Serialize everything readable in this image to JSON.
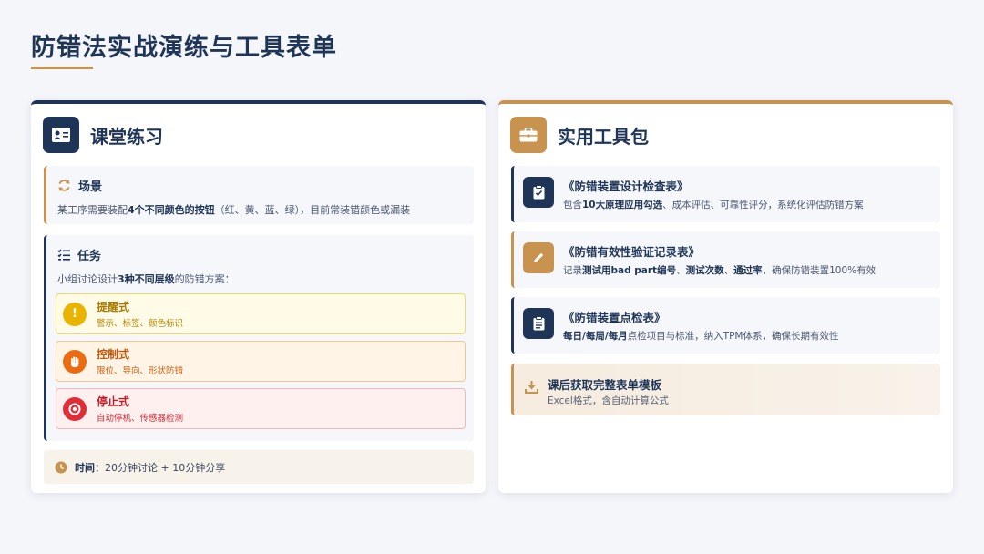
{
  "page": {
    "title": "防错法实战演练与工具表单"
  },
  "exercise": {
    "title": "课堂练习",
    "scene": {
      "label": "场景",
      "text_before": "某工序需要装配",
      "text_bold": "4个不同颜色的按钮",
      "text_after": "（红、黄、蓝、绿），目前常装错颜色或漏装"
    },
    "task": {
      "label": "任务",
      "intro_before": "小组讨论设计",
      "intro_bold": "3种不同层级",
      "intro_after": "的防错方案：",
      "levels": [
        {
          "name": "提醒式",
          "desc": "警示、标签、颜色标识",
          "icon": "!",
          "color": "#e8b400"
        },
        {
          "name": "控制式",
          "desc": "限位、导向、形状防错",
          "icon": "hand-icon",
          "color": "#ec6b10"
        },
        {
          "name": "停止式",
          "desc": "自动停机、传感器检测",
          "icon": "stop-icon",
          "color": "#e12d37"
        }
      ]
    },
    "time": {
      "label": "时间",
      "value": "：20分钟讨论 + 10分钟分享"
    }
  },
  "toolkit": {
    "title": "实用工具包",
    "tools": [
      {
        "name": "《防错装置设计检查表》",
        "desc_parts": [
          {
            "text": "包含",
            "bold": false
          },
          {
            "text": "10大原理应用勾选",
            "bold": true
          },
          {
            "text": "、成本评估、可靠性评分，系统化评估防错方案",
            "bold": false
          }
        ]
      },
      {
        "name": "《防错有效性验证记录表》",
        "desc_parts": [
          {
            "text": "记录",
            "bold": false
          },
          {
            "text": "测试用bad part编号",
            "bold": true
          },
          {
            "text": "、",
            "bold": false
          },
          {
            "text": "测试次数",
            "bold": true
          },
          {
            "text": "、",
            "bold": false
          },
          {
            "text": "通过率",
            "bold": true
          },
          {
            "text": "，确保防错装置100%有效",
            "bold": false
          }
        ]
      },
      {
        "name": "《防错装置点检表》",
        "desc_parts": [
          {
            "text": "每日/每周/每月",
            "bold": true
          },
          {
            "text": "点检项目与标准，纳入TPM体系，确保长期有效性",
            "bold": false
          }
        ]
      }
    ],
    "download": {
      "title": "课后获取完整表单模板",
      "desc": "Excel格式，含自动计算公式"
    }
  },
  "colors": {
    "navy": "#1f3557",
    "gold": "#c8924f"
  }
}
